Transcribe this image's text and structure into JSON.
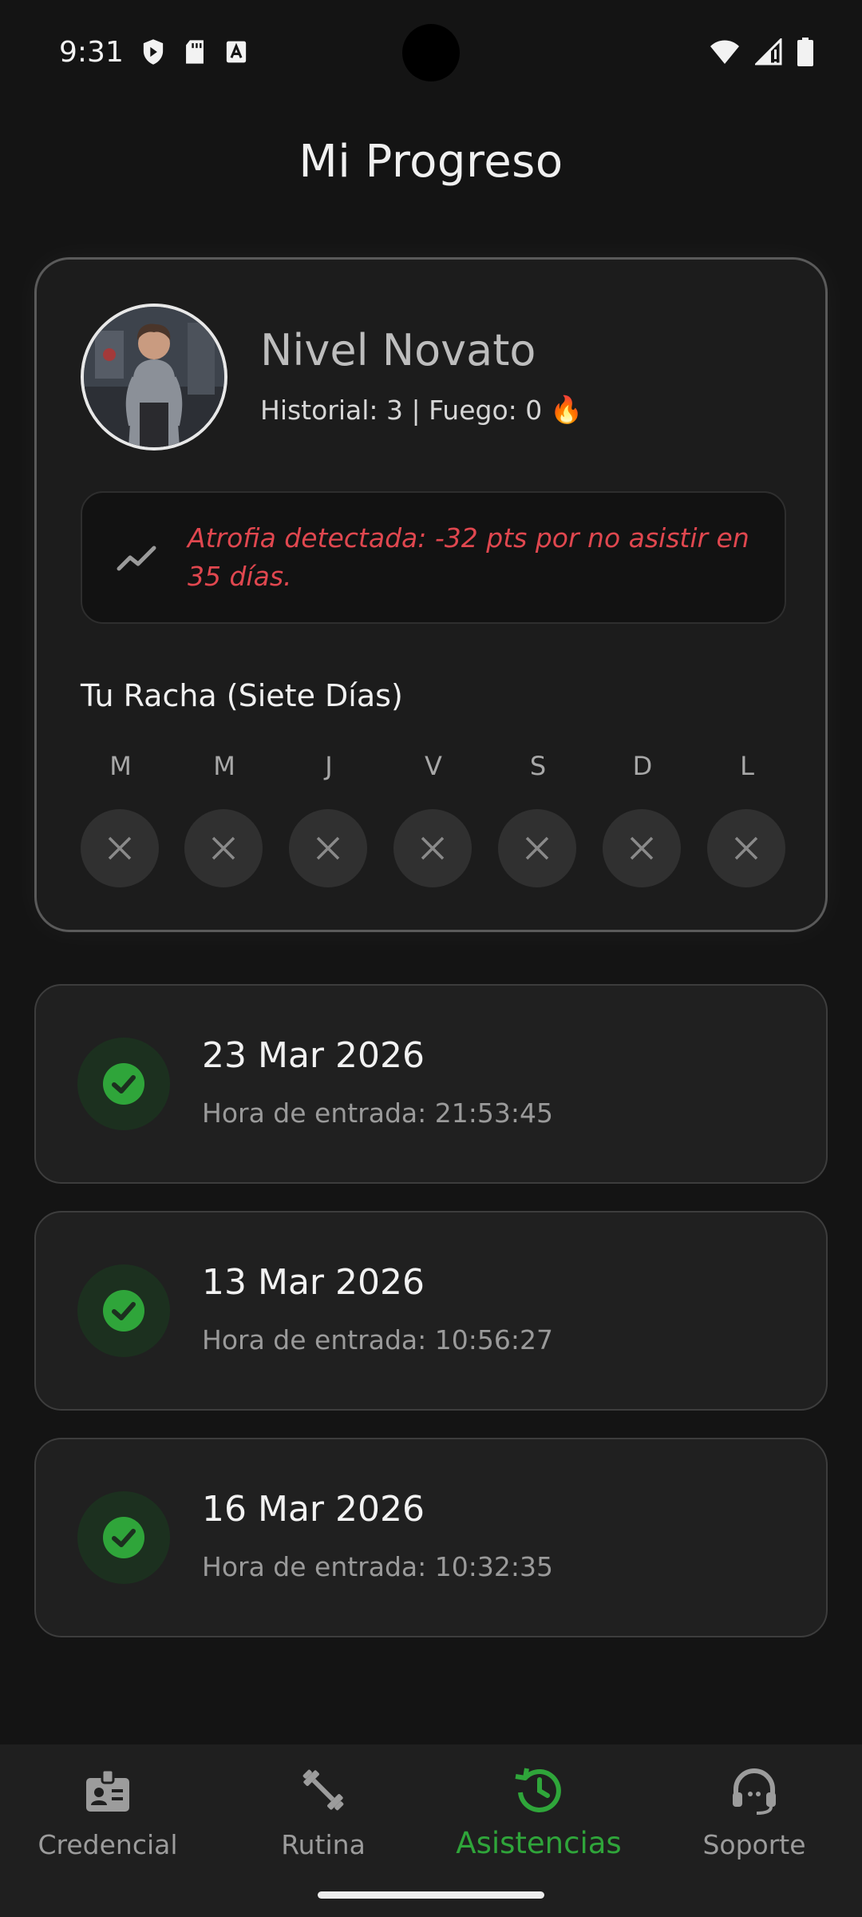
{
  "status_bar": {
    "time": "9:31",
    "icons_left": [
      "shield-icon",
      "sd-card-icon",
      "keyboard-a-icon"
    ],
    "icons_right": [
      "wifi-icon",
      "signal-icon",
      "battery-icon"
    ]
  },
  "page": {
    "title": "Mi Progreso"
  },
  "profile": {
    "level": "Nivel Novato",
    "stats": "Historial: 3 | Fuego: 0",
    "fire_emoji": "🔥"
  },
  "alert": {
    "text": "Atrofia detectada: -32 pts por no asistir en 35 días.",
    "color": "#e0474f"
  },
  "streak": {
    "title": "Tu Racha (Siete Días)",
    "days": [
      {
        "letter": "M",
        "attended": false
      },
      {
        "letter": "M",
        "attended": false
      },
      {
        "letter": "J",
        "attended": false
      },
      {
        "letter": "V",
        "attended": false
      },
      {
        "letter": "S",
        "attended": false
      },
      {
        "letter": "D",
        "attended": false
      },
      {
        "letter": "L",
        "attended": false
      }
    ]
  },
  "visits": [
    {
      "date": "23 Mar 2026",
      "entry": "Hora de entrada: 21:53:45"
    },
    {
      "date": "13 Mar 2026",
      "entry": "Hora de entrada: 10:56:27"
    },
    {
      "date": "16 Mar 2026",
      "entry": "Hora de entrada: 10:32:35"
    }
  ],
  "nav": {
    "items": [
      {
        "label": "Credencial",
        "icon": "badge-icon",
        "active": false
      },
      {
        "label": "Rutina",
        "icon": "dumbbell-icon",
        "active": false
      },
      {
        "label": "Asistencias",
        "icon": "history-icon",
        "active": true
      },
      {
        "label": "Soporte",
        "icon": "headset-icon",
        "active": false
      }
    ]
  },
  "colors": {
    "accent_green": "#2fa53a",
    "background": "#141414"
  }
}
